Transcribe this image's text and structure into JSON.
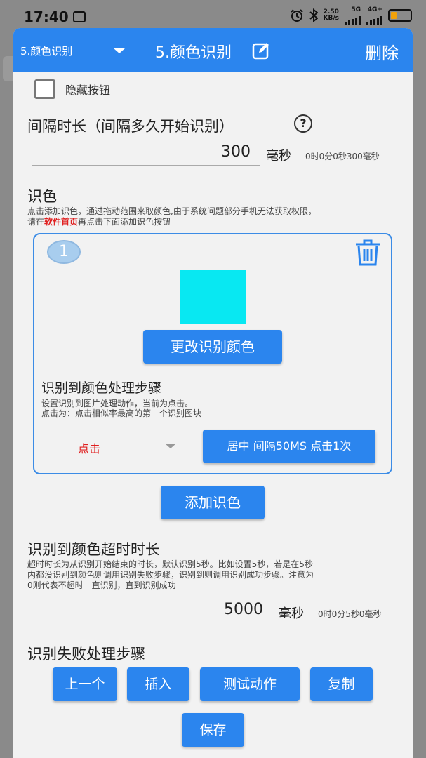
{
  "status_bar": {
    "time": "17:40",
    "speed_value": "2.50",
    "speed_unit": "KB/s",
    "net1": "5G",
    "net2": "4G+"
  },
  "header": {
    "dropdown_value": "5.颜色识别",
    "title": "5.颜色识别",
    "delete_label": "删除"
  },
  "hide_button": {
    "label": "隐藏按钮",
    "checked": false
  },
  "interval": {
    "title": "间隔时长（间隔多久开始识别）",
    "help_icon": "?",
    "value": "300",
    "unit": "毫秒",
    "duration_text": "0时0分0秒300毫秒"
  },
  "color_section": {
    "title": "识色",
    "desc_line1": "点击添加识色，通过拖动范围来取颜色,由于系统问题部分手机无法获取权限，",
    "desc_line2_before": "请在",
    "desc_line2_link": "软件首页",
    "desc_line2_after": "再点击下面添加识色按钮"
  },
  "color_item": {
    "index": "1",
    "swatch_color": "#08e8f2",
    "change_button": "更改识别颜色",
    "step_title": "识别到颜色处理步骤",
    "step_desc1": "设置识别到图片处理动作，当前为点击。",
    "step_desc2": "点击为：点击相似率最高的第一个识别图块",
    "action_value": "点击",
    "action_detail_button": "居中 间隔50MS 点击1次"
  },
  "add_color_button": "添加识色",
  "timeout": {
    "title": "识别到颜色超时时长",
    "desc_line1": "超时时长为从识别开始结束的时长，默认识别5秒。比如设置5秒，若是在5秒",
    "desc_line2": "内都没识别到颜色则调用识别失败步骤，识别到则调用识别成功步骤。注意为",
    "desc_line3": "0则代表不超时一直识别，直到识别成功",
    "value": "5000",
    "unit": "毫秒",
    "duration_text": "0时0分5秒0毫秒"
  },
  "fail_steps": {
    "title": "识别失败处理步骤"
  },
  "bottom_buttons": {
    "prev": "上一个",
    "insert": "插入",
    "test": "测试动作",
    "copy": "复制",
    "save": "保存"
  },
  "colors": {
    "primary": "#2b85ee",
    "highlight_red": "#e02020",
    "swatch": "#08e8f2"
  }
}
